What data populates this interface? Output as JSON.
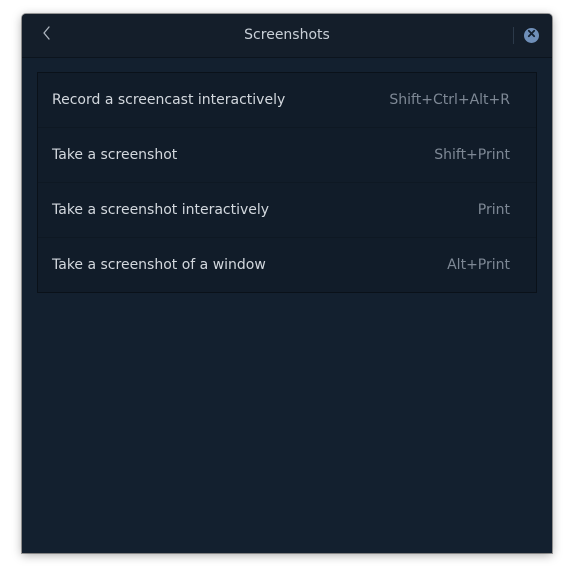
{
  "window": {
    "title": "Screenshots",
    "back_icon": "chevron-left-icon",
    "close_icon": "close-icon"
  },
  "shortcuts": [
    {
      "label": "Record a screencast interactively",
      "accel": "Shift+Ctrl+Alt+R"
    },
    {
      "label": "Take a screenshot",
      "accel": "Shift+Print"
    },
    {
      "label": "Take a screenshot interactively",
      "accel": "Print"
    },
    {
      "label": "Take a screenshot of a window",
      "accel": "Alt+Print"
    }
  ],
  "colors": {
    "window_bg": "#13202f",
    "titlebar_bg": "#141e2a",
    "list_bg": "#111c29",
    "label_text": "#d3d8de",
    "accel_text": "#7e8895",
    "close_accent": "#6f8fb8"
  }
}
